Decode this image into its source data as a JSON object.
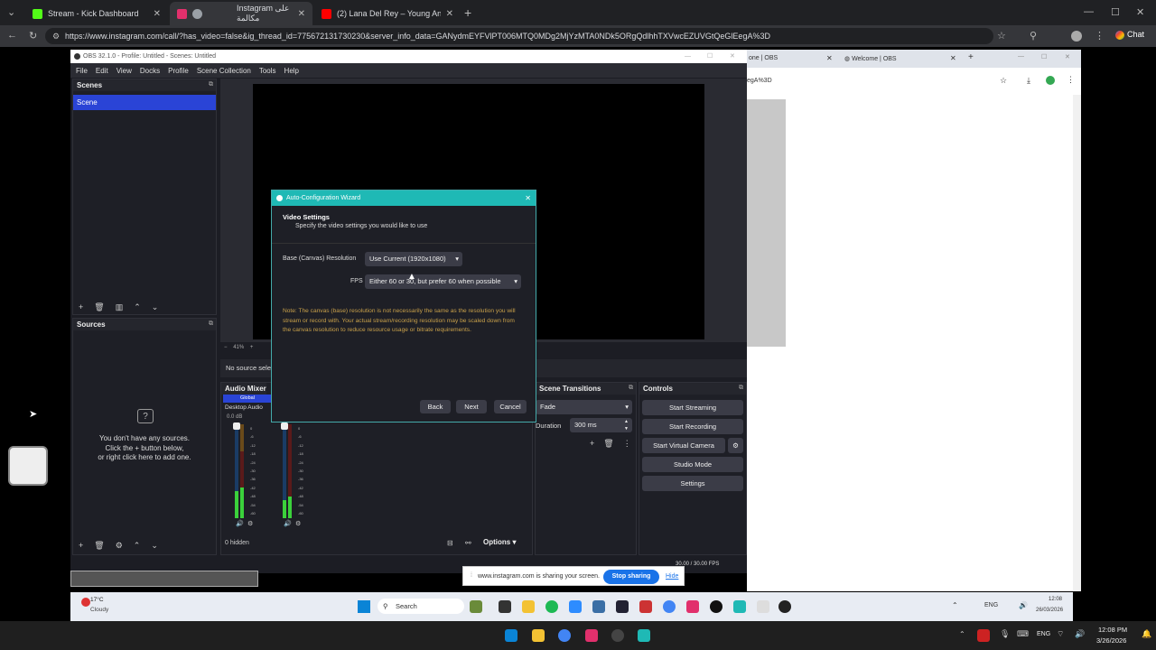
{
  "browser": {
    "tabs": [
      {
        "label": "Stream - Kick Dashboard",
        "color": "#53fc18"
      },
      {
        "label": "Instagram على مكالمة",
        "color": "#e1306c"
      },
      {
        "label": "(2) Lana Del Rey – Young And Bea",
        "color": "#ff0000"
      }
    ],
    "url": "https://www.instagram.com/call/?has_video=false&ig_thread_id=775672131730230&server_info_data=GANydmEYFVlPT006MTQ0MDg2MjYzMTA0NDk5ORgQdlhhTXVwcEZUVGtQeGlEegA%3D",
    "chat_label": "Chat"
  },
  "right_window": {
    "tab1": "one | OBS",
    "tab2": "Welcome | OBS",
    "url_fragment": "egA%3D"
  },
  "obs": {
    "title": "OBS 32.1.0 - Profile: Untitled - Scenes: Untitled",
    "menu": [
      "File",
      "Edit",
      "View",
      "Docks",
      "Profile",
      "Scene Collection",
      "Tools",
      "Help"
    ],
    "scenes_header": "Scenes",
    "scene_item": "Scene",
    "sources_header": "Sources",
    "no_sources_lines": [
      "You don't have any sources.",
      "Click the + button below,",
      "or right click here to add one."
    ],
    "no_source_selected": "No source sele",
    "zoom": "41%",
    "audio_mixer_header": "Audio Mixer",
    "global_label": "Global",
    "desktop_audio": "Desktop Audio",
    "db_value": "0.0 dB",
    "meter_ticks": [
      "0",
      "-6",
      "-12",
      "-18",
      "-24",
      "-30",
      "-36",
      "-42",
      "-48",
      "-54",
      "-60"
    ],
    "hidden_label": "0 hidden",
    "options_label": "Options",
    "scene_transitions_header": "Scene Transitions",
    "transition": "Fade",
    "duration_label": "Duration",
    "duration_value": "300 ms",
    "controls_header": "Controls",
    "controls": [
      "Start Streaming",
      "Start Recording",
      "Start Virtual Camera",
      "Studio Mode",
      "Settings"
    ],
    "status_fps": "30.00 / 30.00 FPS"
  },
  "wizard": {
    "title": "Auto-Configuration Wizard",
    "heading": "Video Settings",
    "subheading": "Specify the video settings you would like to use",
    "base_label": "Base (Canvas) Resolution",
    "base_value": "Use Current (1920x1080)",
    "fps_label": "FPS",
    "fps_value": "Either 60 or 30, but prefer 60 when possible",
    "note": "Note: The canvas (base) resolution is not necessarily the same as the resolution you will stream or record with. Your actual stream/recording resolution may be scaled down from the canvas resolution to reduce resource usage or bitrate requirements.",
    "back": "Back",
    "next": "Next",
    "cancel": "Cancel"
  },
  "share_bar": {
    "text": "www.instagram.com is sharing your screen.",
    "stop": "Stop sharing",
    "hide": "Hide"
  },
  "inner_taskbar": {
    "weather_temp": "17°C",
    "weather_desc": "Cloudy",
    "search": "Search",
    "lang": "ENG",
    "time": "12:08",
    "date": "26/03/2026"
  },
  "outer_taskbar": {
    "lang": "ENG",
    "time": "12:08 PM",
    "date": "3/26/2026"
  }
}
